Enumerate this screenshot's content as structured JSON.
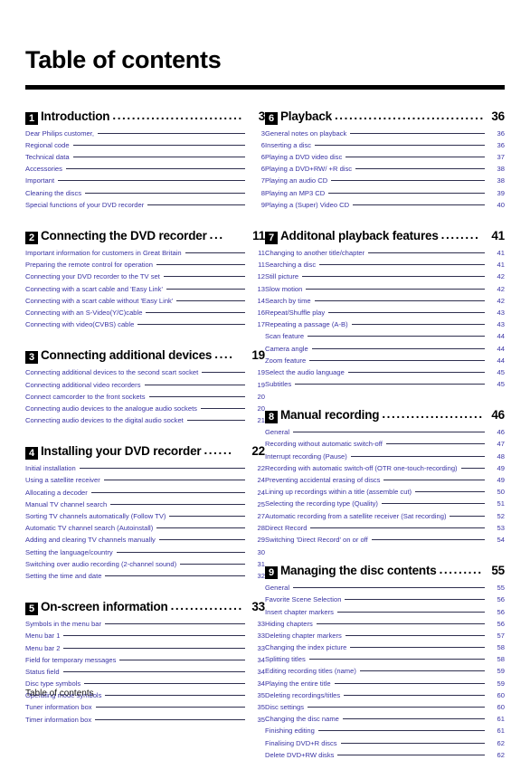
{
  "document": {
    "title": "Table of contents",
    "footer": "Table of contents"
  },
  "colors": {
    "entry_text": "#3a34a4",
    "heading_text": "#000000",
    "rule": "#000000"
  },
  "columns": [
    {
      "sections": [
        {
          "number": "1",
          "title": "Introduction",
          "dots": "...................................",
          "page": "3",
          "entries": [
            {
              "label": "Dear Philips customer,",
              "page": "3"
            },
            {
              "label": "Regional code",
              "page": "6"
            },
            {
              "label": "Technical data",
              "page": "6"
            },
            {
              "label": "Accessories",
              "page": "6"
            },
            {
              "label": "Important",
              "page": "7"
            },
            {
              "label": "Cleaning the discs",
              "page": "8"
            },
            {
              "label": "Special functions of your DVD recorder",
              "page": "9"
            }
          ]
        },
        {
          "number": "2",
          "title": "Connecting the DVD recorder",
          "dots": "...",
          "page": "11",
          "entries": [
            {
              "label": "Important information for customers in Great Britain",
              "page": "11"
            },
            {
              "label": "Preparing the remote control for operation",
              "page": "11"
            },
            {
              "label": "Connecting your DVD recorder to the TV set",
              "page": "12"
            },
            {
              "label": "Connecting with a scart cable and 'Easy Link'",
              "page": "13"
            },
            {
              "label": "Connecting with a scart cable without 'Easy Link'",
              "page": "14"
            },
            {
              "label": "Connecting with an S-Video(Y/C)cable",
              "page": "16"
            },
            {
              "label": "Connecting with video(CVBS) cable",
              "page": "17"
            }
          ]
        },
        {
          "number": "3",
          "title": "Connecting additional devices",
          "dots": "....",
          "page": "19",
          "entries": [
            {
              "label": "Connecting additional devices to the second scart socket",
              "page": "19"
            },
            {
              "label": "Connecting additional video recorders",
              "page": "19"
            },
            {
              "label": "Connect camcorder to the front sockets",
              "page": "20"
            },
            {
              "label": "Connecting audio devices to the analogue audio sockets",
              "page": "20"
            },
            {
              "label": "Connecting audio devices to the digital audio socket",
              "page": "21"
            }
          ]
        },
        {
          "number": "4",
          "title": "Installing your DVD recorder",
          "dots": "......",
          "page": "22",
          "entries": [
            {
              "label": "Initial installation",
              "page": "22"
            },
            {
              "label": "Using a satellite receiver",
              "page": "24"
            },
            {
              "label": "Allocating a decoder",
              "page": "24"
            },
            {
              "label": "Manual TV channel search",
              "page": "25"
            },
            {
              "label": "Sorting TV channels automatically (Follow TV)",
              "page": "27"
            },
            {
              "label": "Automatic TV channel search (Autoinstall)",
              "page": "28"
            },
            {
              "label": "Adding and clearing TV channels manually",
              "page": "29"
            },
            {
              "label": "Setting the language/country",
              "page": "30"
            },
            {
              "label": "Switching over audio recording (2-channel sound)",
              "page": "31"
            },
            {
              "label": "Setting the time and date",
              "page": "32"
            }
          ]
        },
        {
          "number": "5",
          "title": "On-screen information",
          "dots": "...............",
          "page": "33",
          "entries": [
            {
              "label": "Symbols in the menu bar",
              "page": "33"
            },
            {
              "label": "Menu bar 1",
              "page": "33"
            },
            {
              "label": "Menu bar 2",
              "page": "33"
            },
            {
              "label": "Field for temporary messages",
              "page": "34"
            },
            {
              "label": "Status field",
              "page": "34"
            },
            {
              "label": "Disc type symbols",
              "page": "34"
            },
            {
              "label": "Operating mode symbols",
              "page": "35"
            },
            {
              "label": "Tuner information box",
              "page": "35"
            },
            {
              "label": "Timer information box",
              "page": "35"
            }
          ]
        }
      ]
    },
    {
      "sections": [
        {
          "number": "6",
          "title": "Playback",
          "dots": "........................................",
          "page": "36",
          "entries": [
            {
              "label": "General notes on playback",
              "page": "36"
            },
            {
              "label": "Inserting a disc",
              "page": "36"
            },
            {
              "label": "Playing a DVD video disc",
              "page": "37"
            },
            {
              "label": "Playing a DVD+RW/ +R disc",
              "page": "38"
            },
            {
              "label": "Playing an audio CD",
              "page": "38"
            },
            {
              "label": "Playing an MP3 CD",
              "page": "39"
            },
            {
              "label": "Playing a (Super) Video CD",
              "page": "40"
            }
          ]
        },
        {
          "number": "7",
          "title": "Additonal playback features",
          "dots": "........",
          "page": "41",
          "entries": [
            {
              "label": "Changing to another title/chapter",
              "page": "41"
            },
            {
              "label": "Searching a disc",
              "page": "41"
            },
            {
              "label": "Still picture",
              "page": "42"
            },
            {
              "label": "Slow motion",
              "page": "42"
            },
            {
              "label": "Search by time",
              "page": "42"
            },
            {
              "label": "Repeat/Shuffle play",
              "page": "43"
            },
            {
              "label": "Repeating a passage (A-B)",
              "page": "43"
            },
            {
              "label": "Scan feature",
              "page": "44"
            },
            {
              "label": "Camera angle",
              "page": "44"
            },
            {
              "label": "Zoom feature",
              "page": "44"
            },
            {
              "label": "Select the audio language",
              "page": "45"
            },
            {
              "label": "Subtitles",
              "page": "45"
            }
          ]
        },
        {
          "number": "8",
          "title": "Manual recording",
          "dots": ".........................",
          "page": "46",
          "entries": [
            {
              "label": "General",
              "page": "46"
            },
            {
              "label": "Recording without automatic switch-off",
              "page": "47"
            },
            {
              "label": "Interrupt recording (Pause)",
              "page": "48"
            },
            {
              "label": "Recording with automatic switch-off (OTR one-touch-recording)",
              "page": "49"
            },
            {
              "label": "Preventing accidental erasing of discs",
              "page": "49"
            },
            {
              "label": "Lining up recordings within a title (assemble cut)",
              "page": "50"
            },
            {
              "label": "Selecting the recording type (Quality)",
              "page": "51"
            },
            {
              "label": "Automatic recording from a satellite receiver (Sat recording)",
              "page": "52"
            },
            {
              "label": "Direct Record",
              "page": "53"
            },
            {
              "label": "Switching 'Direct Record' on or off",
              "page": "54"
            }
          ]
        },
        {
          "number": "9",
          "title": "Managing the disc contents",
          "dots": ".........",
          "page": "55",
          "entries": [
            {
              "label": "General",
              "page": "55"
            },
            {
              "label": "Favorite Scene Selection",
              "page": "56"
            },
            {
              "label": "Insert chapter markers",
              "page": "56"
            },
            {
              "label": "Hiding chapters",
              "page": "56"
            },
            {
              "label": "Deleting chapter markers",
              "page": "57"
            },
            {
              "label": "Changing the index picture",
              "page": "58"
            },
            {
              "label": "Splitting titles",
              "page": "58"
            },
            {
              "label": "Editing recording titles (name)",
              "page": "59"
            },
            {
              "label": "Playing the entire title",
              "page": "59"
            },
            {
              "label": "Deleting recordings/titles",
              "page": "60"
            },
            {
              "label": "Disc settings",
              "page": "60"
            },
            {
              "label": "Changing the disc name",
              "page": "61"
            },
            {
              "label": "Finishing editing",
              "page": "61"
            },
            {
              "label": "Finalising DVD+R discs",
              "page": "62"
            },
            {
              "label": "Delete DVD+RW disks",
              "page": "62"
            }
          ]
        }
      ]
    }
  ]
}
